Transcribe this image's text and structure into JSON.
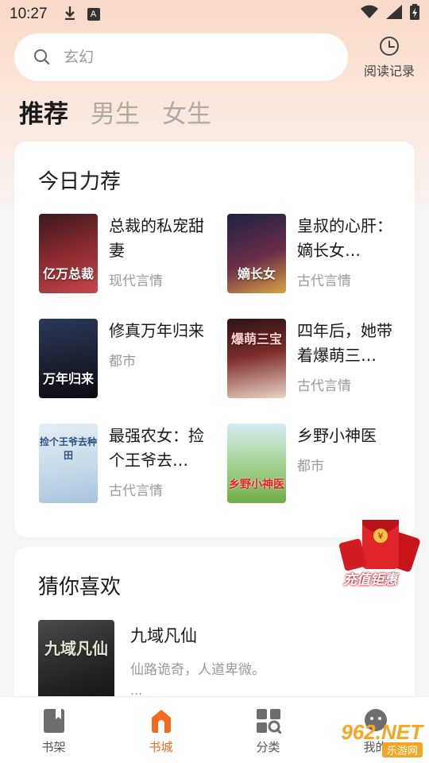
{
  "status_bar": {
    "time": "10:27",
    "notification_icons": [
      "download-icon",
      "a-icon"
    ],
    "system_icons": [
      "wifi-icon",
      "signal-icon",
      "battery-icon"
    ]
  },
  "search": {
    "placeholder": "玄幻"
  },
  "history": {
    "label": "阅读记录",
    "icon": "clock-icon"
  },
  "tabs": [
    {
      "label": "推荐",
      "active": true
    },
    {
      "label": "男生",
      "active": false
    },
    {
      "label": "女生",
      "active": false
    }
  ],
  "today_section": {
    "title": "今日力荐",
    "books": [
      {
        "title": "总裁的私宠甜妻",
        "genre": "现代言情",
        "cover_text": "亿万总裁"
      },
      {
        "title": "皇叔的心肝：嫡长女…",
        "genre": "古代言情",
        "cover_text": "嫡长女"
      },
      {
        "title": "修真万年归来",
        "genre": "都市",
        "cover_text": "万年归来"
      },
      {
        "title": "四年后，她带着爆萌三…",
        "genre": "古代言情",
        "cover_text": "爆萌三宝"
      },
      {
        "title": "最强农女：捡个王爷去…",
        "genre": "古代言情",
        "cover_text": "捡个王爷去种田"
      },
      {
        "title": "乡野小神医",
        "genre": "都市",
        "cover_text": "乡野小神医"
      }
    ]
  },
  "guess_section": {
    "title": "猜你喜欢",
    "book": {
      "title": "九域凡仙",
      "desc": "仙路诡奇，人道卑微。",
      "ellipsis": "...",
      "cover_text": "九域凡仙"
    }
  },
  "promo": {
    "label": "充值钜惠"
  },
  "bottom_nav": [
    {
      "label": "书架",
      "icon": "bookshelf-icon",
      "active": false
    },
    {
      "label": "书城",
      "icon": "bookstore-icon",
      "active": true
    },
    {
      "label": "分类",
      "icon": "category-icon",
      "active": false
    },
    {
      "label": "我的",
      "icon": "profile-icon",
      "active": false
    }
  ],
  "watermark": {
    "main": "962.NET",
    "sub": "乐游网"
  },
  "colors": {
    "accent": "#f26a1b",
    "header_gradient_top": "#f9d9c8",
    "promo_red": "#e0262b"
  }
}
